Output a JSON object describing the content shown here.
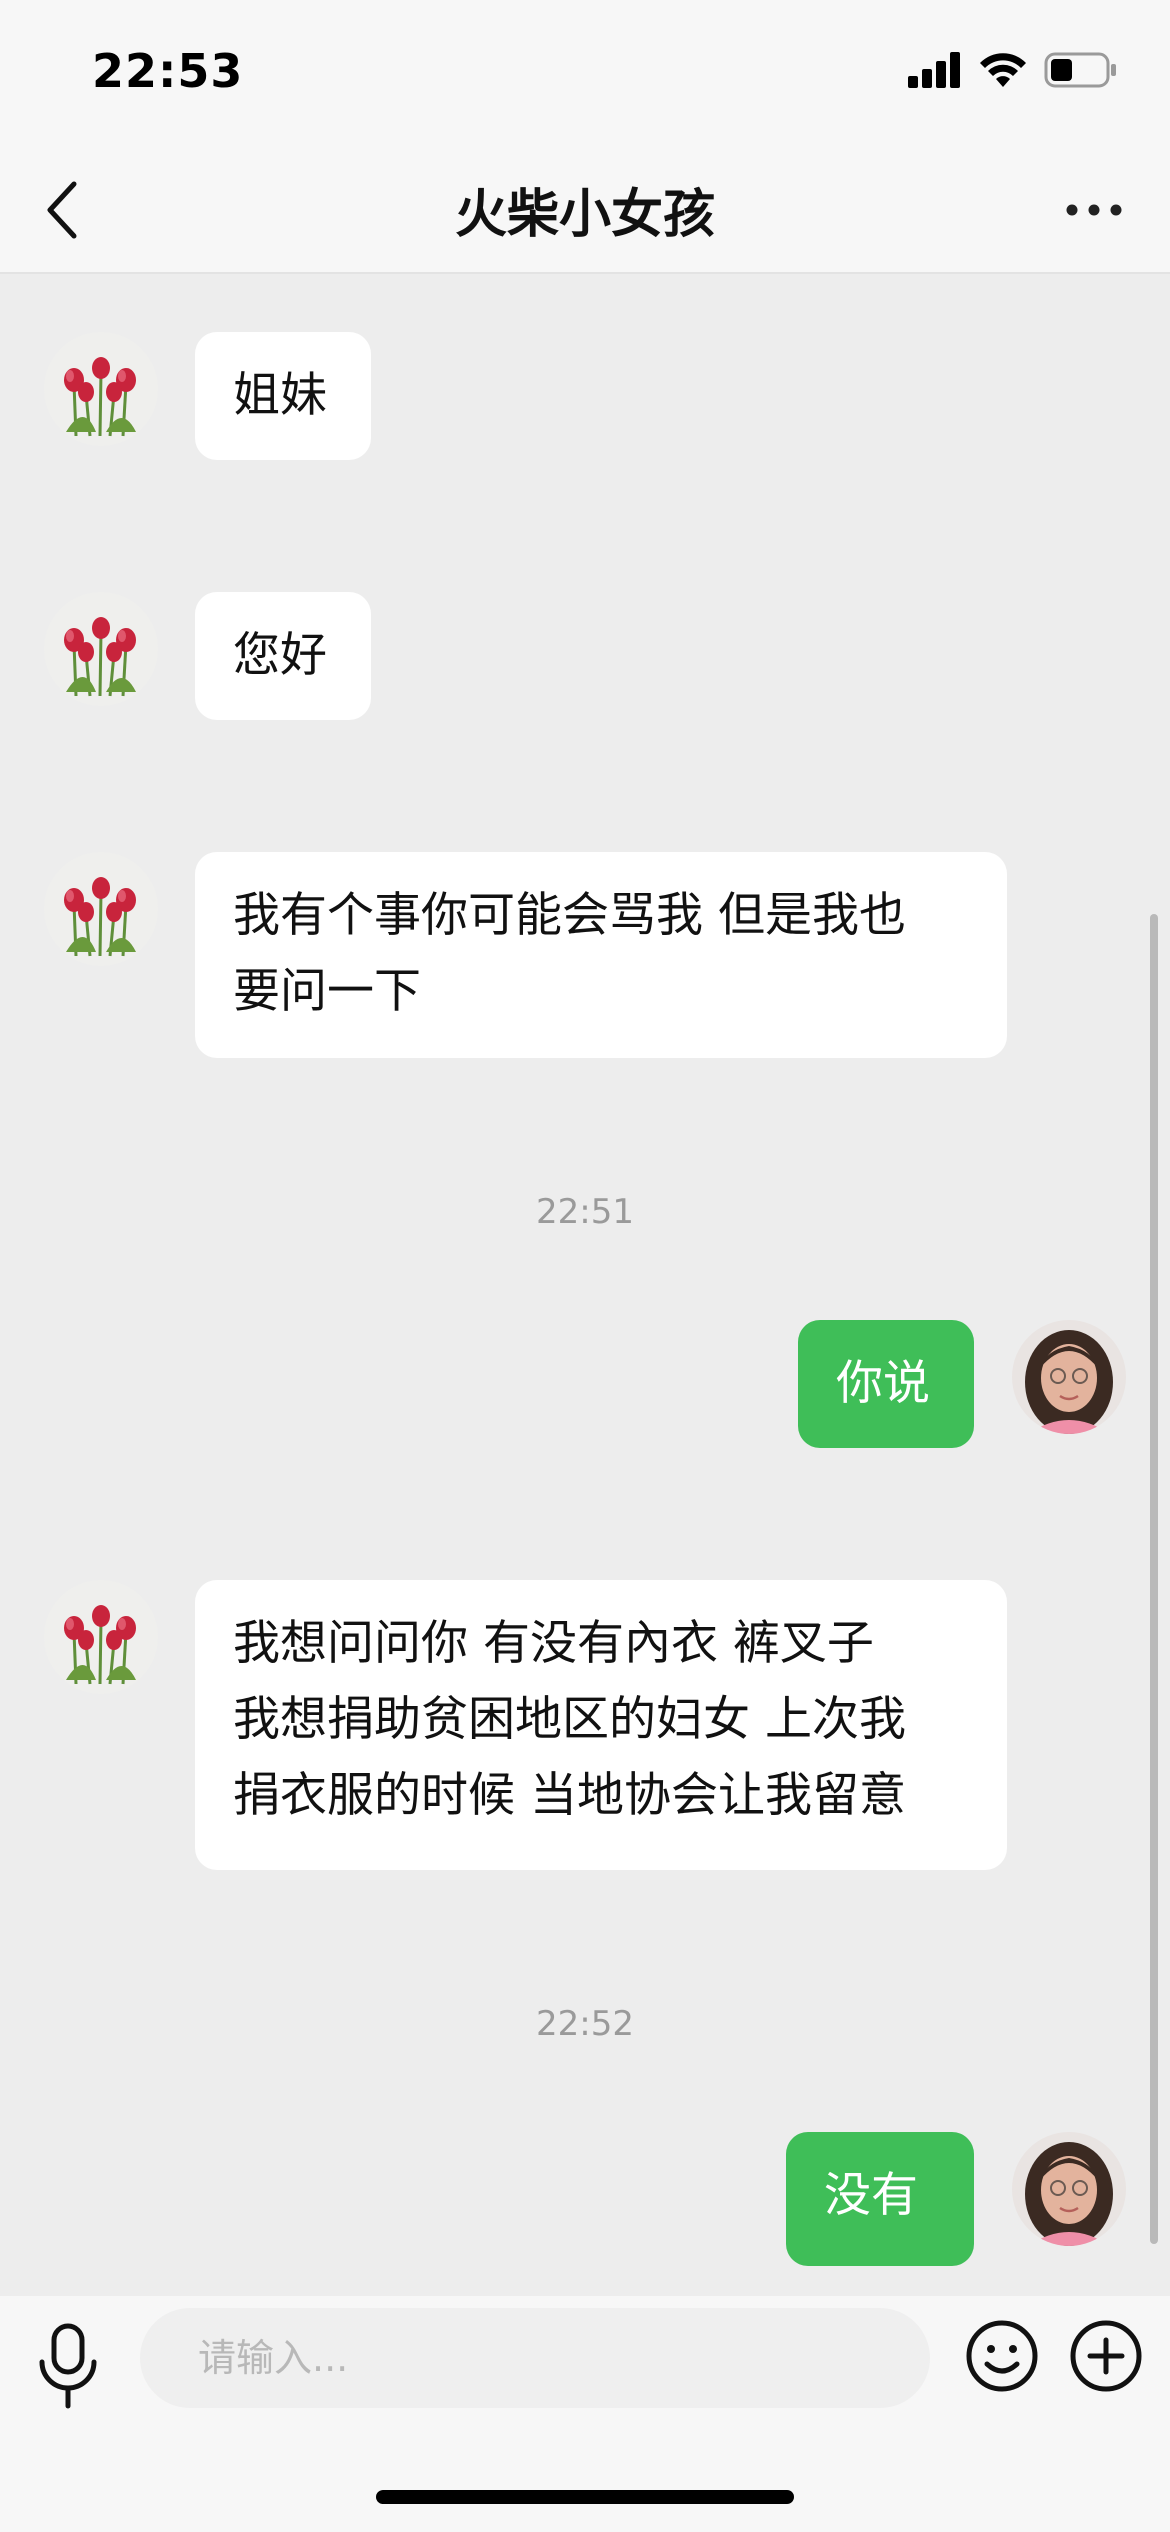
{
  "status_bar": {
    "time": "22:53",
    "icons": [
      "signal-icon",
      "wifi-icon",
      "battery-icon"
    ],
    "battery_level": 0.4
  },
  "header": {
    "title": "火柴小女孩",
    "back_icon": "chevron-left-icon",
    "more_icon": "more-dots-icon"
  },
  "messages": [
    {
      "side": "in",
      "text": "姐妹"
    },
    {
      "side": "in",
      "text": "您好"
    },
    {
      "side": "in",
      "lines": [
        "我有个事你可能会骂我 但是我也",
        "要问一下"
      ]
    },
    {
      "type": "time",
      "text": "22:51"
    },
    {
      "side": "out",
      "text": "你说"
    },
    {
      "side": "in",
      "lines": [
        "我想问问你 有没有內衣  裤叉子",
        "我想捐助贫困地区的妇女 上次我",
        "捐衣服的时候 当地协会让我留意"
      ]
    },
    {
      "type": "time",
      "text": "22:52"
    },
    {
      "side": "out",
      "text": "没有"
    }
  ],
  "input": {
    "placeholder": "请输入...",
    "mic_icon": "microphone-icon",
    "emoji_icon": "smiley-icon",
    "plus_icon": "plus-circle-icon"
  },
  "colors": {
    "outgoing_bubble": "#3fbe58",
    "incoming_bubble": "#ffffff",
    "chat_background": "#ededed"
  }
}
